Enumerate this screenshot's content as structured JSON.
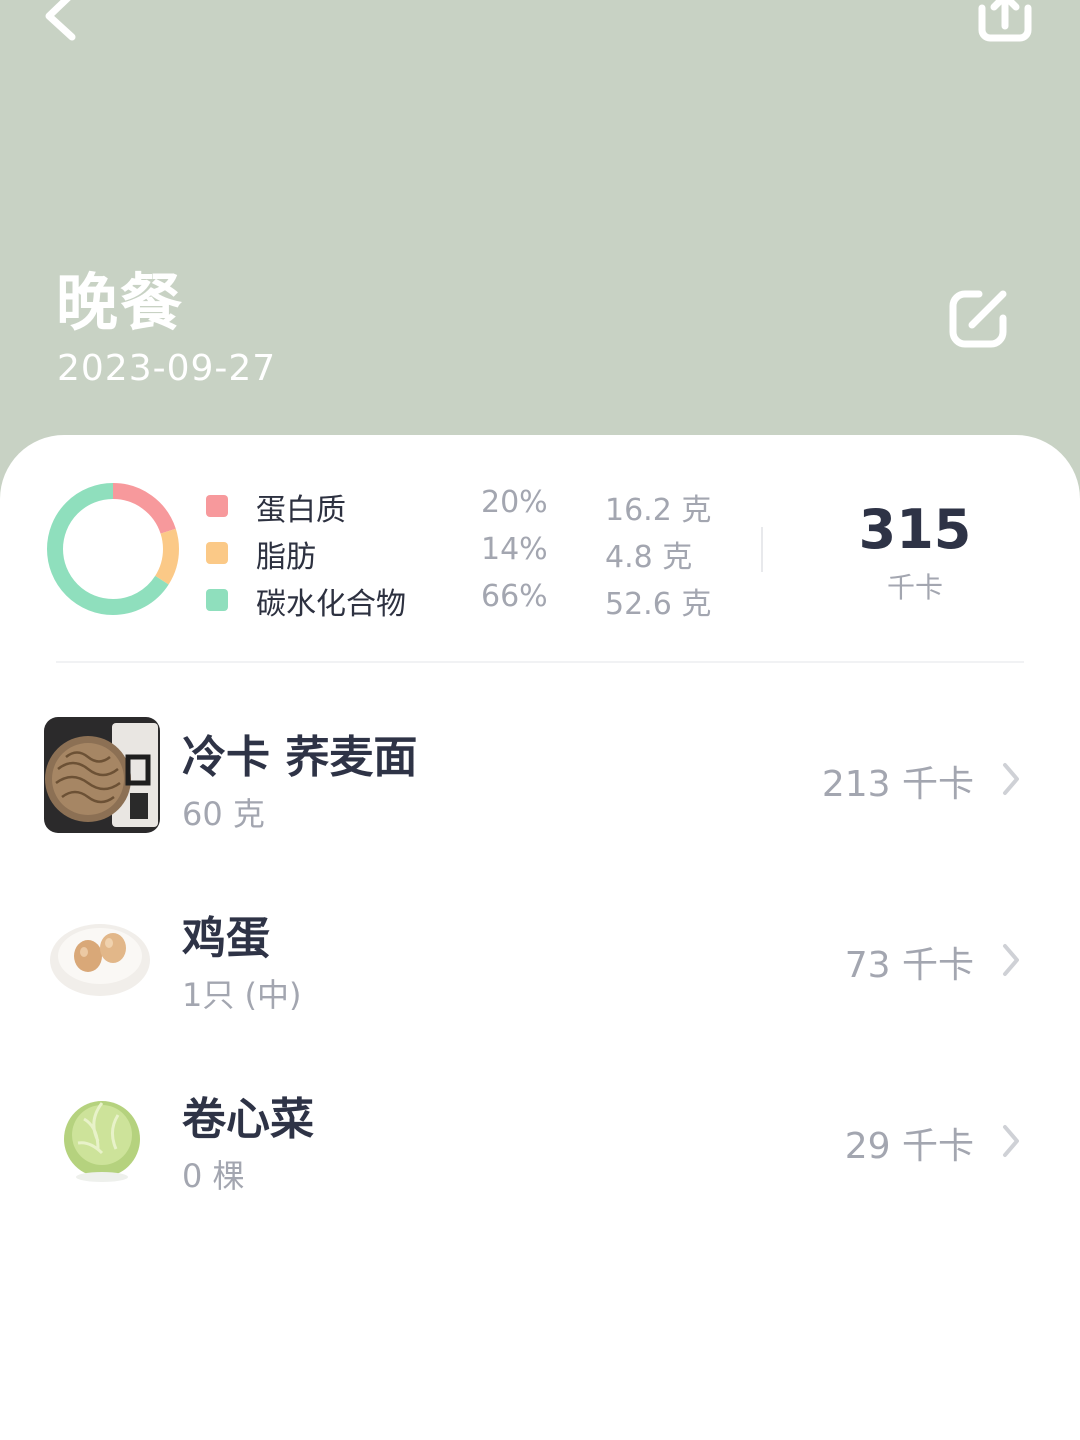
{
  "header": {
    "meal_name": "晚餐",
    "date": "2023-09-27",
    "background_color": "#c8d2c4"
  },
  "icons": {
    "back": "chevron-left-icon",
    "share": "share-upload-icon",
    "edit": "edit-pencil-icon",
    "row_arrow": "chevron-right-icon"
  },
  "nutrition": {
    "legend": [
      {
        "name": "蛋白质",
        "percent": "20%",
        "grams": "16.2 克",
        "color": "#f7999c"
      },
      {
        "name": "脂肪",
        "percent": "14%",
        "grams": "4.8 克",
        "color": "#fbc987"
      },
      {
        "name": "碳水化合物",
        "percent": "66%",
        "grams": "52.6 克",
        "color": "#8fdfbd"
      }
    ],
    "total_kcal": "315",
    "kcal_unit": "千卡"
  },
  "foods": [
    {
      "name": "冷卡 荞麦面",
      "amount": "60 克",
      "kcal": "213 千卡",
      "image": "buckwheat-noodle-package"
    },
    {
      "name": "鸡蛋",
      "amount": "1只 (中)",
      "kcal": "73 千卡",
      "image": "eggs-on-plate"
    },
    {
      "name": "卷心菜",
      "amount": "0 棵",
      "kcal": "29 千卡",
      "image": "cabbage"
    }
  ]
}
